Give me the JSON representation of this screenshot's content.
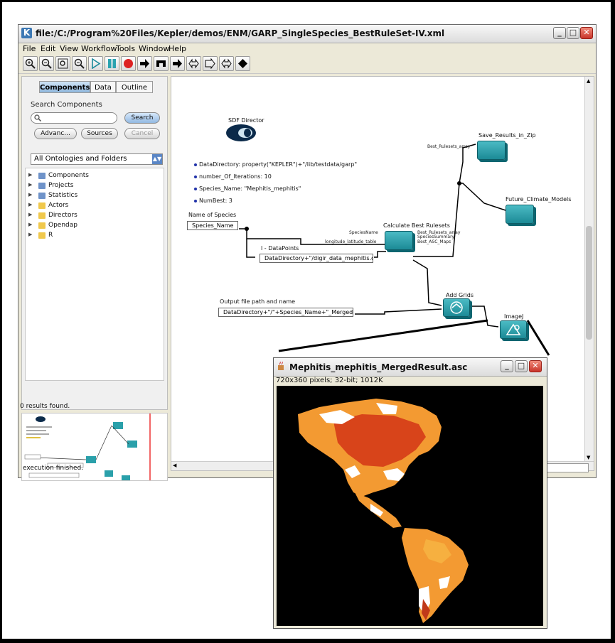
{
  "kepler": {
    "title": "file:/C:/Program%20Files/Kepler/demos/ENM/GARP_SingleSpecies_BestRuleSet-IV.xml",
    "menu": [
      "File",
      "Edit",
      "View",
      "Workflow",
      "Tools",
      "Window",
      "Help"
    ],
    "window_buttons": {
      "minimize": "_",
      "maximize": "□",
      "close": "✕"
    },
    "tabs": [
      "Components",
      "Data",
      "Outline"
    ],
    "active_tab": "Components",
    "search": {
      "label": "Search Components",
      "button": "Search",
      "advanced": "Advanc...",
      "sources": "Sources",
      "cancel": "Cancel"
    },
    "ontology_select": "All Ontologies and Folders",
    "tree": [
      {
        "label": "Components",
        "kind": "blue"
      },
      {
        "label": "Projects",
        "kind": "blue"
      },
      {
        "label": "Statistics",
        "kind": "blue"
      },
      {
        "label": "Actors",
        "kind": "folder"
      },
      {
        "label": "Directors",
        "kind": "folder"
      },
      {
        "label": "Opendap",
        "kind": "folder"
      },
      {
        "label": "R",
        "kind": "folder"
      }
    ],
    "results": "0 results found.",
    "status": "execution finished."
  },
  "workflow": {
    "director": "SDF Director",
    "params": [
      "DataDirectory: property(\"KEPLER\")+\"/lib/testdata/garp\"",
      "number_Of_Iterations: 10",
      "Species_Name: \"Mephitis_mephitis\"",
      "NumBest: 3"
    ],
    "name_of_species_label": "Name of Species",
    "name_of_species_value": "Species_Name",
    "datapoints_label": "l - DataPoints",
    "datapoints_value": "DataDirectory+\"/digir_data_mephitis.dat\"",
    "output_label": "Output file path and name",
    "output_value": "DataDirectory+\"/\"+Species_Name+\"_MergedR...",
    "calc_label": "Calculate Best Rulesets",
    "save_label": "Save_Results_in_Zip",
    "future_label": "Future_Climate_Models",
    "addgrids_label": "Add Grids",
    "imagej_label": "ImageJ",
    "ports": {
      "species_name": "SpeciesName",
      "lon_lat": "longitude_latitude_table",
      "best_rulesets": "Best_Rulesets_array",
      "species_summary": "SpeciesSummary",
      "best_asc": "Best_ASC_Maps",
      "best_rulesets_in": "Best_Rulesets_array"
    }
  },
  "image_window": {
    "title": "Mephitis_mephitis_MergedResult.asc",
    "info": "720x360 pixels; 32-bit; 1012K",
    "buttons": {
      "minimize": "_",
      "maximize": "□",
      "close": "✕"
    }
  }
}
